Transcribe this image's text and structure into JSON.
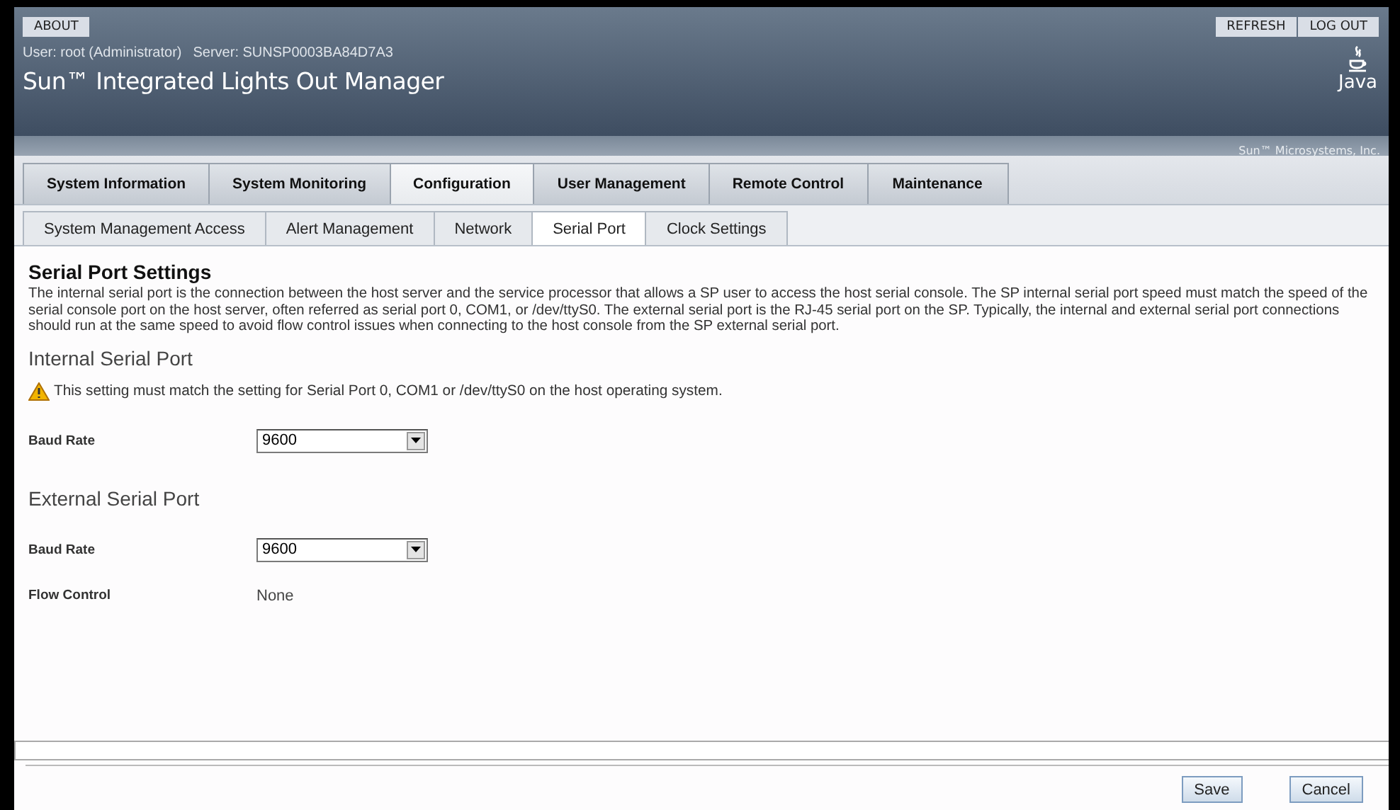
{
  "header": {
    "left_buttons": [
      "ABOUT"
    ],
    "right_buttons": [
      "REFRESH",
      "LOG OUT"
    ],
    "user": "User: root (Administrator)",
    "server": "Server: SUNSP0003BA84D7A3",
    "title": "Sun™ Integrated Lights Out Manager",
    "logo_text": "Java",
    "company": "Sun™ Microsystems, Inc."
  },
  "tabs": [
    {
      "label": "System Information",
      "selected": false
    },
    {
      "label": "System Monitoring",
      "selected": false
    },
    {
      "label": "Configuration",
      "selected": true
    },
    {
      "label": "User Management",
      "selected": false
    },
    {
      "label": "Remote Control",
      "selected": false
    },
    {
      "label": "Maintenance",
      "selected": false
    }
  ],
  "subtabs": [
    {
      "label": "System Management Access",
      "selected": false
    },
    {
      "label": "Alert Management",
      "selected": false
    },
    {
      "label": "Network",
      "selected": false
    },
    {
      "label": "Serial Port",
      "selected": true
    },
    {
      "label": "Clock Settings",
      "selected": false
    }
  ],
  "content": {
    "heading": "Serial Port Settings",
    "description": "The internal serial port is the connection between the host server and the service processor that allows a SP user to access the host serial console. The SP internal serial port speed must match the speed of the serial console port on the host server, often referred as serial port 0, COM1, or /dev/ttyS0. The external serial port is the RJ-45 serial port on the SP. Typically, the internal and external serial port connections should run at the same speed to avoid flow control issues when connecting to the host console from the SP external serial port.",
    "sections": [
      {
        "title": "Internal Serial Port",
        "warning": "This setting must match the setting for Serial Port 0, COM1 or /dev/ttyS0 on the host operating system.",
        "fields": [
          {
            "kind": "dropdown",
            "label": "Baud Rate",
            "value": "9600"
          }
        ]
      },
      {
        "title": "External Serial Port",
        "fields": [
          {
            "kind": "dropdown",
            "label": "Baud Rate",
            "value": "9600"
          },
          {
            "kind": "text",
            "label": "Flow Control",
            "value": "None"
          }
        ]
      }
    ]
  },
  "buttons": [
    "Save",
    "Cancel"
  ]
}
